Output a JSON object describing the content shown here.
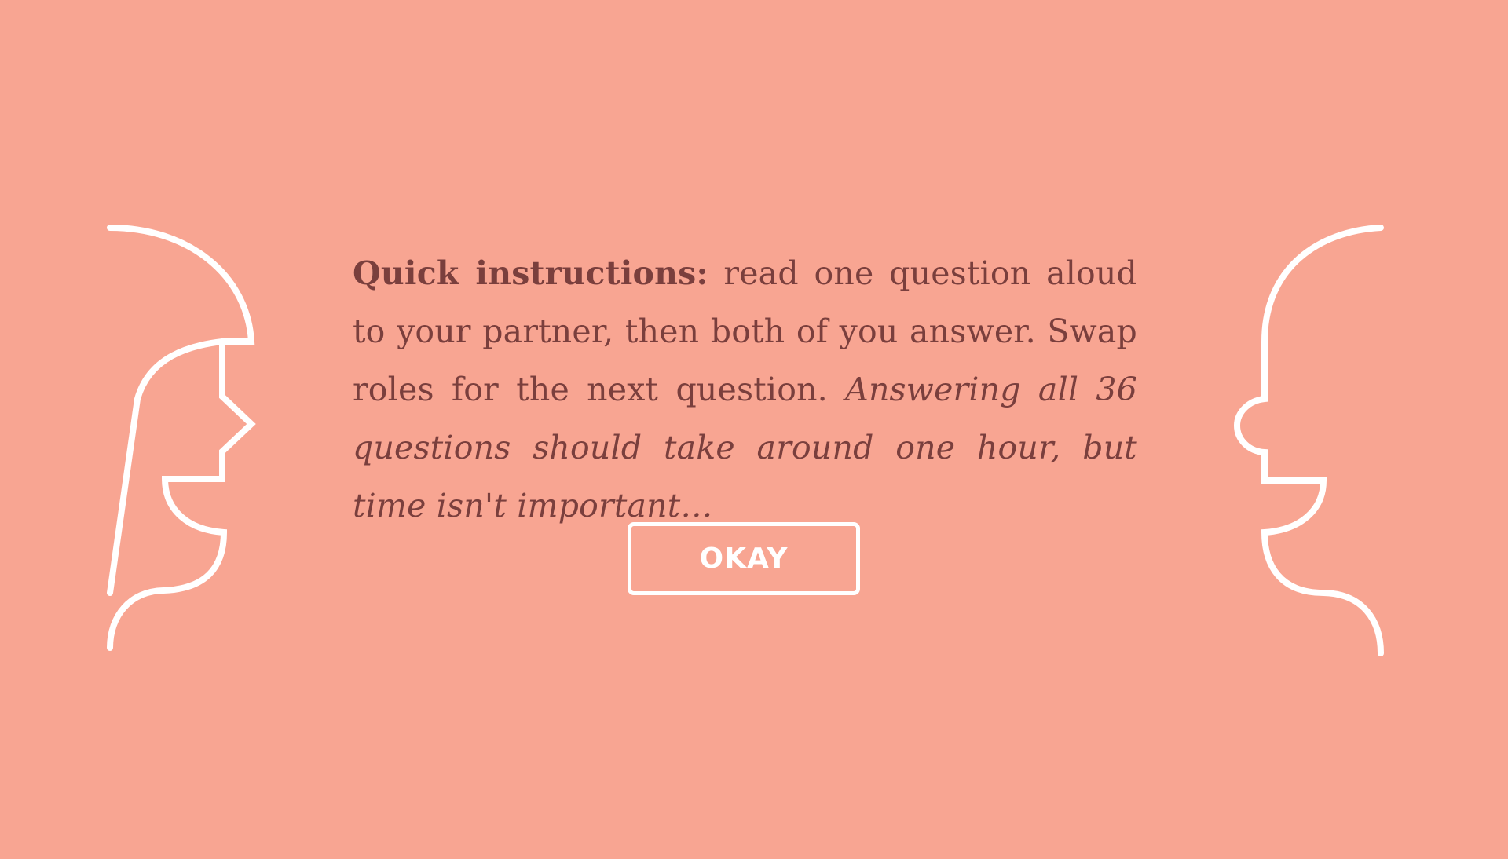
{
  "background_color": "#F8A592",
  "text_color": "#7A3F3D",
  "line_color": "#FFFFFF",
  "instructions": {
    "heading": "Quick instructions:",
    "body": " read one question aloud to your partner, then both of you answer. Swap roles for the next question. ",
    "note": "Answering all 36 questions should take around one hour, but time isn't important…"
  },
  "okay_button": {
    "label": "OKAY"
  },
  "icons": {
    "left": "woman-profile-icon",
    "right": "man-profile-icon"
  }
}
